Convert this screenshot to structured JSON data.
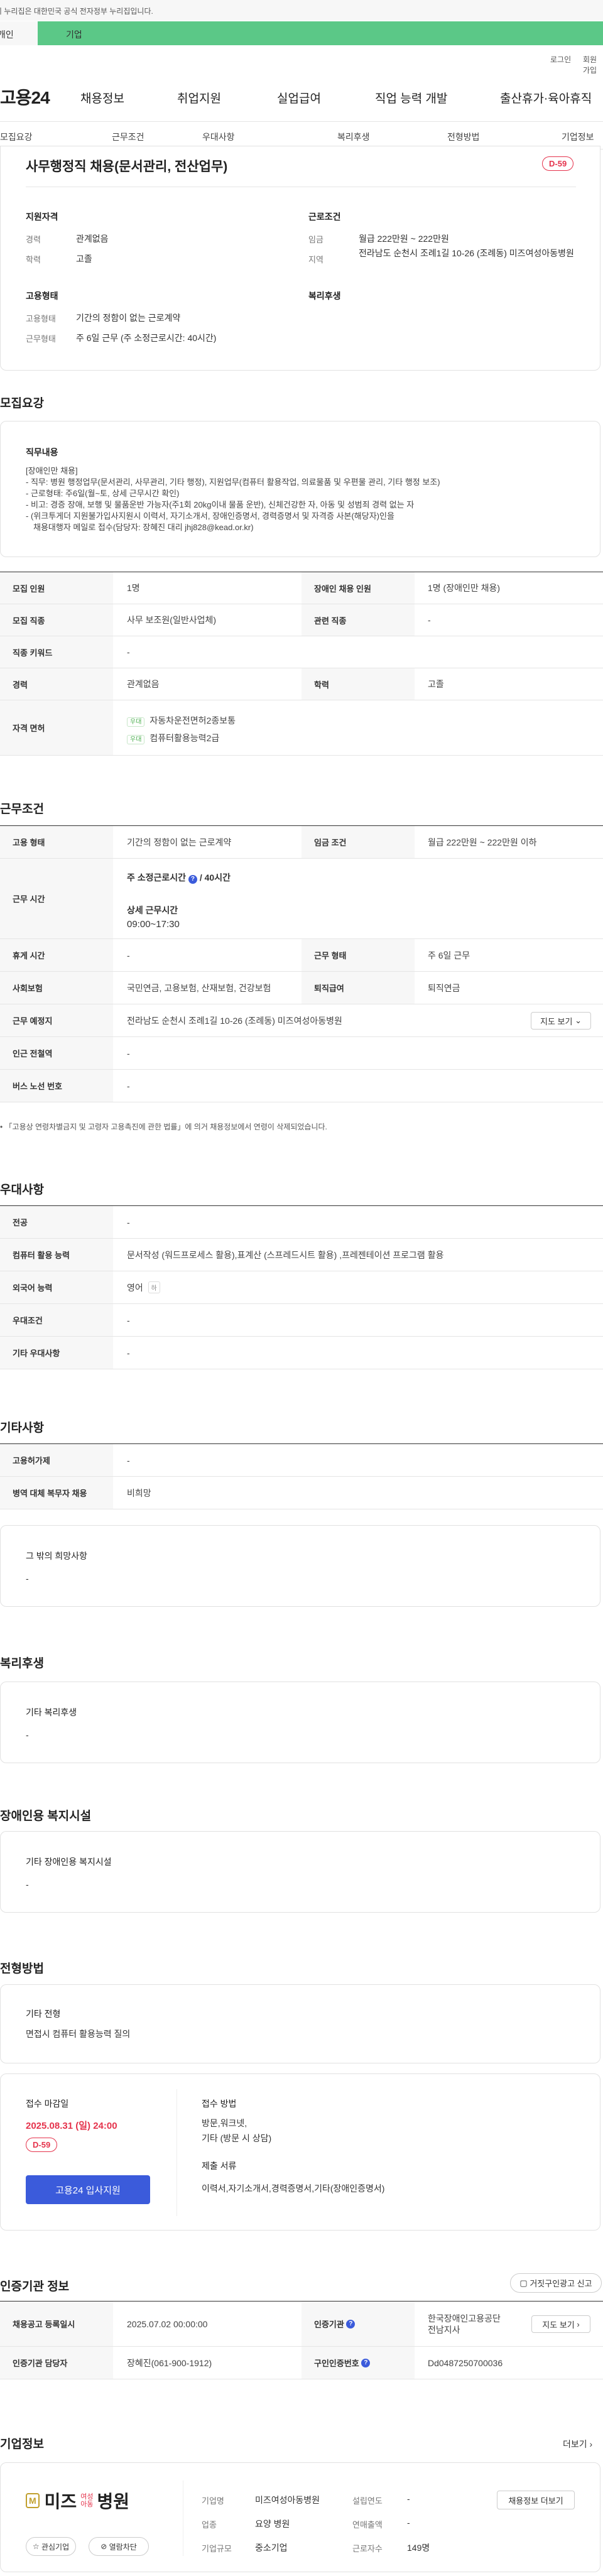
{
  "notice": "이 누리집은 대한민국 공식 전자정부 누리집입니다.",
  "gov_tabs": [
    "개인",
    "기업"
  ],
  "top_links": [
    "로그인",
    "회원가입"
  ],
  "logo": "고용24",
  "gnb": [
    "채용정보",
    "취업지원",
    "실업급여",
    "직업 능력 개발",
    "출산휴가·육아휴직"
  ],
  "subnav": [
    "모집요강",
    "근무조건",
    "우대사항",
    "복리후생",
    "전형방법",
    "기업정보"
  ],
  "summary": {
    "title": "사무행정직 채용(문서관리, 전산업무)",
    "dday": "D-59",
    "qual_h": "지원자격",
    "exp_l": "경력",
    "exp_v": "관계없음",
    "edu_l": "학력",
    "edu_v": "고졸",
    "cond_h": "근로조건",
    "wage_l": "임금",
    "wage_v": "월급 222만원 ~ 222만원",
    "area_l": "지역",
    "area_v": "전라남도 순천시 조례1길 10-26 (조례동) 미즈여성아동병원",
    "emp_h": "고용형태",
    "type_l": "고용형태",
    "type_v": "기간의 정함이 없는 근로계약",
    "hours_l": "근무형태",
    "hours_v": "주 6일 근무 (주 소정근로시간: 40시간)",
    "welfare_h": "복리후생"
  },
  "s_recruit": "모집요강",
  "job": {
    "h": "직무내용",
    "lines": [
      "[장애인만 채용]",
      "- 직무: 병원 행정업무(문서관리, 사무관리, 기타 행정), 지원업무(컴퓨터 활용작업, 의료물품 및 우편물 관리, 기타 행정 보조)",
      "- 근로형태: 주6일(월~토, 상세 근무시간 확인)",
      "- 비고: 경증 장애, 보행 및 물품운반 가능자(주1회 20kg이내 물품 운반), 신체건강한 자, 아동 및 성범죄 경력 없는 자",
      "- (위크투게더 지원불가입사지원시 이력서, 자기소개서, 장애인증명서, 경력증명서 및 자격증 사본(해당자)인을",
      "채용대행자 메일로 접수(담당자: 장혜진 대리 jhj828@kead.or.kr)"
    ]
  },
  "t1": {
    "r1": [
      "모집 인원",
      "1명",
      "장애인 채용 인원",
      "1명 (장애인만 채용)"
    ],
    "r2": [
      "모집 직종",
      "사무 보조원(일반사업체)",
      "관련 직종",
      "-"
    ],
    "r3": [
      "직종 키워드",
      "-"
    ],
    "r4": [
      "경력",
      "관계없음",
      "학력",
      "고졸"
    ],
    "r5_h": "자격 면허",
    "lic": [
      {
        "tag": "우대",
        "name": "자동차운전면허2종보통"
      },
      {
        "tag": "우대",
        "name": "컴퓨터활용능력2급"
      }
    ]
  },
  "s_cond": "근무조건",
  "t2": {
    "r1": [
      "고용 형태",
      "기간의 정함이 없는 근로계약",
      "임금 조건",
      "월급 222만원 ~ 222만원 이하"
    ],
    "r2_h": "근무 시간",
    "r2_a": "주 소정근로시간",
    "r2_b": "40시간",
    "r2_c": "상세 근무시간",
    "r2_d": "09:00~17:30",
    "r3": [
      "휴게 시간",
      "-",
      "근무 형태",
      "주 6일 근무"
    ],
    "r4": [
      "사회보험",
      "국민연금, 고용보험, 산재보험, 건강보험",
      "퇴직급여",
      "퇴직연금"
    ],
    "r5": [
      "근무 예정지",
      "전라남도 순천시 조례1길 10-26 (조례동) 미즈여성아동병원"
    ],
    "map": "지도 보기",
    "r6": [
      "인근 전철역",
      "-"
    ],
    "r7": [
      "버스 노선 번호",
      "-"
    ]
  },
  "foot_note": "「고용상 연령차별금지 및 고령자 고용촉진에 관한 법률」에 의거 채용정보에서 연령이 삭제되었습니다.",
  "s_pref": "우대사항",
  "t3": {
    "r1": [
      "전공",
      "-"
    ],
    "r2": [
      "컴퓨터 활용 능력",
      "문서작성 (워드프로세스 활용),표계산 (스프레드시트 활용) ,프레젠테이션 프로그램 활용"
    ],
    "r3_h": "외국어 능력",
    "r3_v": "영어",
    "r3_tag": "하",
    "r4": [
      "우대조건",
      "-"
    ],
    "r5": [
      "기타 우대사항",
      "-"
    ]
  },
  "s_etc": "기타사항",
  "t4": {
    "r1": [
      "고용허가제",
      "-"
    ],
    "r2": [
      "병역 대체 복무자 채용",
      "비희망"
    ]
  },
  "box_etc": {
    "h": "그 밖의 희망사항",
    "v": "-"
  },
  "s_welfare": "복리후생",
  "box_welfare": {
    "h": "기타 복리후생",
    "v": "-"
  },
  "s_disab": "장애인용 복지시설",
  "box_disab": {
    "h": "기타 장애인용 복지시설",
    "v": "-"
  },
  "s_sel": "전형방법",
  "box_sel": {
    "h": "기타 전형",
    "v": "면접시 컴퓨터 활용능력 질의"
  },
  "apply": {
    "dl_h": "접수 마감일",
    "date": "2025.08.31 (일) 24:00",
    "dday": "D-59",
    "btn": "고용24 입사지원",
    "m_h": "접수 방법",
    "m_v1": "방문,워크넷,",
    "m_v2": "기타 (방문 시 상담)",
    "doc_h": "제출 서류",
    "doc_v": "이력서,자기소개서,경력증명서,기타(장애인증명서)"
  },
  "s_cert": "인증기관 정보",
  "report_btn": "거짓구인광고 신고",
  "t5": {
    "r1": [
      "채용공고 등록일시",
      "2025.07.02 00:00:00",
      "인증기관"
    ],
    "org": "한국장애인고용공단 전남지사",
    "map": "지도 보기",
    "r2": [
      "인증기관 담당자",
      "장혜진(061-900-1912)",
      "구인인증번호",
      "Dd0487250700036"
    ]
  },
  "s_company": "기업정보",
  "more": "더보기",
  "company": {
    "logo_t": "미즈",
    "logo_s1": "여성",
    "logo_s2": "아동",
    "logo_b": "병원",
    "fav": "관심기업",
    "block": "열람차단",
    "info_btn": "채용정보 더보기",
    "c1": [
      [
        "기업명",
        "미즈여성아동병원"
      ],
      [
        "업종",
        "요양 병원"
      ],
      [
        "기업규모",
        "중소기업"
      ]
    ],
    "c2": [
      [
        "설립연도",
        "-"
      ],
      [
        "연매출액",
        "-"
      ],
      [
        "근로자수",
        "149명"
      ]
    ]
  }
}
